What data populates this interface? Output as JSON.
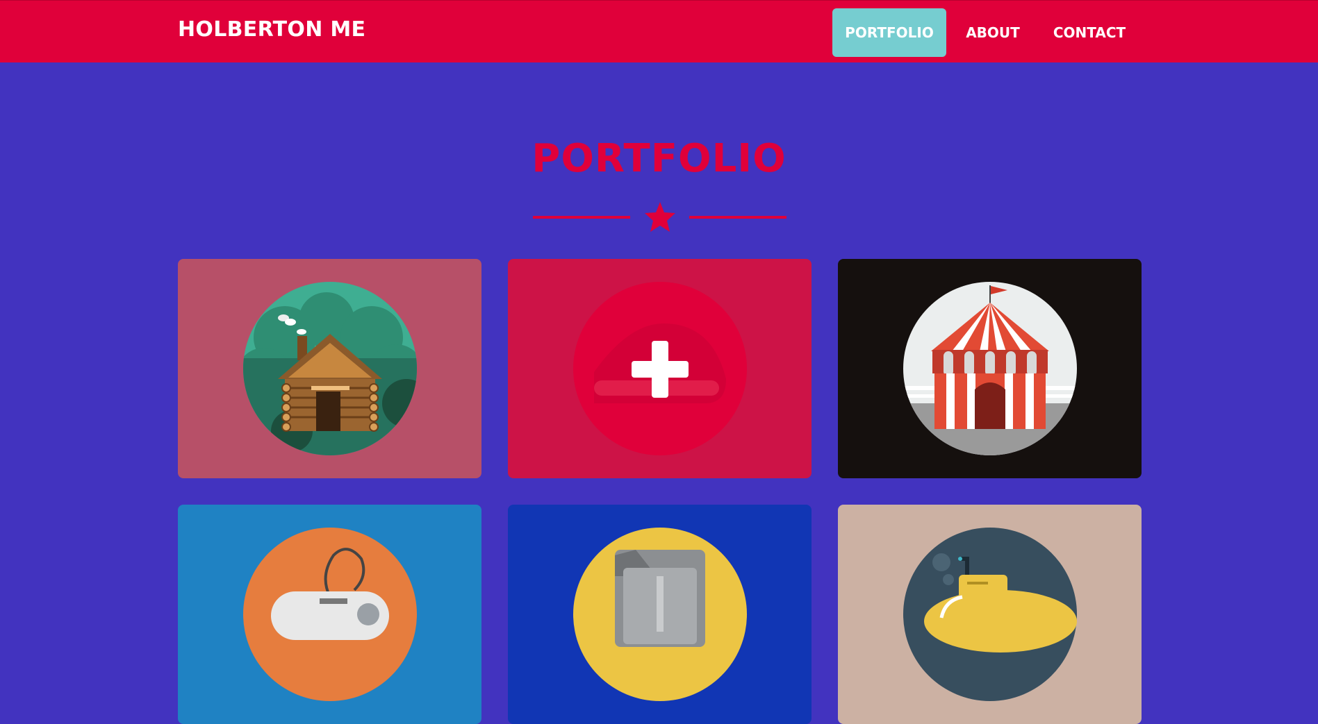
{
  "nav": {
    "brand": "HOLBERTON ME",
    "items": [
      {
        "label": "PORTFOLIO",
        "active": true
      },
      {
        "label": "ABOUT",
        "active": false
      },
      {
        "label": "CONTACT",
        "active": false
      }
    ]
  },
  "portfolio": {
    "title": "PORTFOLIO",
    "divider_icon": "star-icon",
    "items": [
      {
        "icon": "log-cabin-icon",
        "bg": "#b75068",
        "circle": "#3fae92"
      },
      {
        "icon": "plus-icon",
        "bg": "#cd1347",
        "circle": "#e0003a"
      },
      {
        "icon": "circus-tent-icon",
        "bg": "#15100e",
        "circle": "#ebeeee"
      },
      {
        "icon": "game-controller-icon",
        "bg": "#1f82c3",
        "circle": "#e67d3e"
      },
      {
        "icon": "safe-icon",
        "bg": "#1136b4",
        "circle": "#ecc544"
      },
      {
        "icon": "submarine-icon",
        "bg": "#ccb1a3",
        "circle": "#374e5e"
      }
    ]
  },
  "colors": {
    "page_bg": "#4233bf",
    "navbar_bg": "#e0003a",
    "active_nav_bg": "#76cdd0",
    "accent": "#e0003a"
  }
}
